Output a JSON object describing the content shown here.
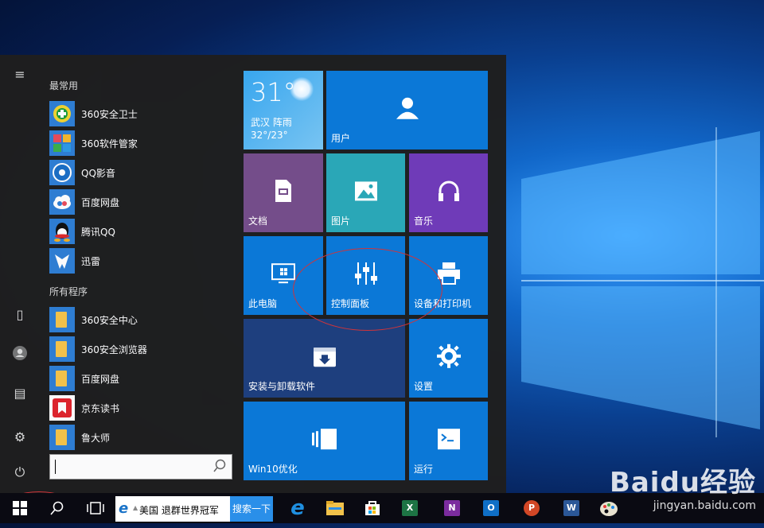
{
  "start_menu": {
    "frequent_header": "最常用",
    "frequent": [
      {
        "label": "360安全卫士",
        "icon": "360-safeguard-icon",
        "color": "#1d9e3a"
      },
      {
        "label": "360软件管家",
        "icon": "360-software-manager-icon",
        "color": "#e34d6a"
      },
      {
        "label": "QQ影音",
        "icon": "qq-player-icon",
        "color": "#1c8fd6"
      },
      {
        "label": "百度网盘",
        "icon": "baidu-netdisk-icon",
        "color": "#2f7fd5"
      },
      {
        "label": "腾讯QQ",
        "icon": "tencent-qq-icon",
        "color": "#222222"
      },
      {
        "label": "迅雷",
        "icon": "xunlei-icon",
        "color": "#2b6fd1"
      }
    ],
    "all_header": "所有程序",
    "all": [
      {
        "label": "360安全中心",
        "icon": "folder-icon"
      },
      {
        "label": "360安全浏览器",
        "icon": "folder-icon"
      },
      {
        "label": "百度网盘",
        "icon": "folder-icon"
      },
      {
        "label": "京东读书",
        "icon": "jd-reader-icon"
      },
      {
        "label": "鲁大师",
        "icon": "folder-icon"
      }
    ]
  },
  "tiles": {
    "weather": {
      "temp": "31°",
      "city": "武汉  阵雨",
      "range": "32°/23°"
    },
    "user": "用户",
    "documents": "文档",
    "pictures": "图片",
    "music": "音乐",
    "this_pc": "此电脑",
    "control_panel": "控制面板",
    "devices_printers": "设备和打印机",
    "install_uninstall": "安装与卸载软件",
    "settings": "设置",
    "win10_optimize": "Win10优化",
    "run": "运行"
  },
  "taskbar": {
    "news_text": "美国 退群世界冠军",
    "search_button": "搜索一下",
    "apps": [
      "edge-icon",
      "file-explorer-icon",
      "store-icon",
      "excel-icon",
      "onenote-icon",
      "outlook-icon",
      "powerpoint-icon",
      "word-icon",
      "paint-icon"
    ]
  },
  "watermark": {
    "brand": "Baidu经验",
    "url": "jingyan.baidu.com"
  }
}
